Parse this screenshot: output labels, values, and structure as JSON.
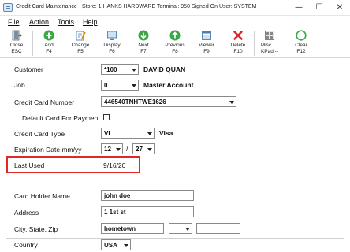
{
  "window": {
    "title": "Credit Card Maintenance - Store: 1   HANKS HARDWARE   Terminal: 950   Signed On User: SYSTEM",
    "min_glyph": "—",
    "max_glyph": "☐",
    "close_glyph": "✕"
  },
  "menu": [
    {
      "label": "File"
    },
    {
      "label": "Action"
    },
    {
      "label": "Tools"
    },
    {
      "label": "Help"
    }
  ],
  "toolbar": [
    {
      "label": "Close",
      "sub": "ESC",
      "icon": "close-door-icon"
    },
    {
      "label": "Add",
      "sub": "F4",
      "icon": "add-icon"
    },
    {
      "label": "Change",
      "sub": "F5",
      "icon": "change-icon"
    },
    {
      "label": "Display",
      "sub": "F6",
      "icon": "display-icon"
    },
    {
      "label": "Next",
      "sub": "F7",
      "icon": "next-icon"
    },
    {
      "label": "Previous",
      "sub": "F8",
      "icon": "previous-icon"
    },
    {
      "label": "Viewer",
      "sub": "F9",
      "icon": "viewer-icon"
    },
    {
      "label": "Delete",
      "sub": "F10",
      "icon": "delete-icon"
    },
    {
      "label": "Misc. ...",
      "sub": "KPad --",
      "icon": "misc-icon"
    },
    {
      "label": "Clear",
      "sub": "F12",
      "icon": "clear-icon"
    }
  ],
  "form": {
    "customer": {
      "label": "Customer",
      "value": "*100",
      "name": "DAVID QUAN"
    },
    "job": {
      "label": "Job",
      "value": "0",
      "name": "Master Account"
    },
    "card_number": {
      "label": "Credit Card Number",
      "value": "446540TNHTWE1626"
    },
    "default_payment": {
      "label": "Default Card For Payment",
      "checked": false
    },
    "card_type": {
      "label": "Credit Card Type",
      "value": "VI",
      "name": "Visa"
    },
    "expiration": {
      "label": "Expiration Date mm/yy",
      "month": "12",
      "year": "27",
      "slash": "/"
    },
    "last_used": {
      "label": "Last Used",
      "value": "9/16/20"
    },
    "holder_name": {
      "label": "Card Holder Name",
      "value": "john doe"
    },
    "address": {
      "label": "Address",
      "value": "1 1st st"
    },
    "city_state_zip": {
      "label": "City, State, Zip",
      "city": "hometown",
      "state": "",
      "zip": ""
    },
    "country": {
      "label": "Country",
      "value": "USA"
    }
  },
  "colors": {
    "highlight": "#e32626",
    "accent": "#1a7fd1"
  }
}
